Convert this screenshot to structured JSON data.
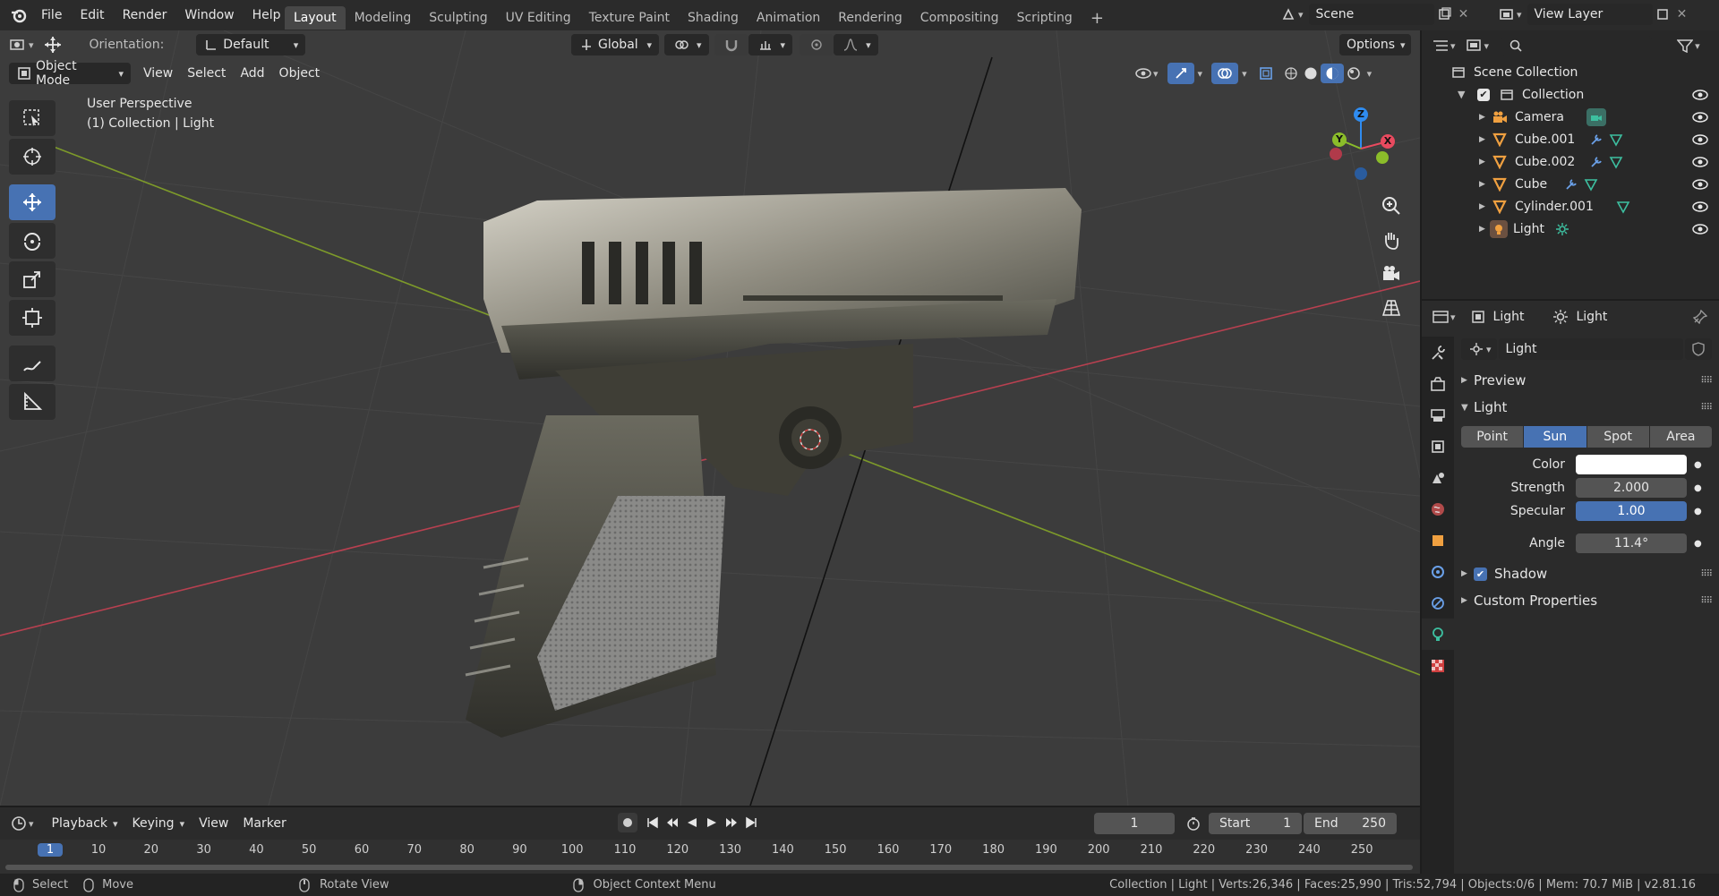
{
  "menu": [
    "File",
    "Edit",
    "Render",
    "Window",
    "Help"
  ],
  "workspaces": [
    {
      "label": "Layout",
      "active": true
    },
    {
      "label": "Modeling"
    },
    {
      "label": "Sculpting"
    },
    {
      "label": "UV Editing"
    },
    {
      "label": "Texture Paint"
    },
    {
      "label": "Shading"
    },
    {
      "label": "Animation"
    },
    {
      "label": "Rendering"
    },
    {
      "label": "Compositing"
    },
    {
      "label": "Scripting"
    }
  ],
  "add_workspace": "+",
  "scene": {
    "name": "Scene"
  },
  "view_layer": {
    "name": "View Layer"
  },
  "viewport": {
    "orientation_label": "Orientation:",
    "orientation_value": "Default",
    "transform_space": "Global",
    "options_label": "Options",
    "mode": "Object Mode",
    "header_menus": [
      "View",
      "Select",
      "Add",
      "Object"
    ],
    "overlay_text_line1": "User Perspective",
    "overlay_text_line2": "(1) Collection | Light",
    "gizmo_axes": {
      "z": "Z",
      "y": "Y",
      "x": "X"
    }
  },
  "outliner": {
    "search_placeholder": "",
    "root": "Scene Collection",
    "collection": "Collection",
    "items": [
      {
        "name": "Camera",
        "icon": "camera-object-icon",
        "extra": "camera-data-icon"
      },
      {
        "name": "Cube.001",
        "icon": "mesh-object-icon",
        "extra": "modifier-wrench-icon"
      },
      {
        "name": "Cube.002",
        "icon": "mesh-object-icon",
        "extra": "modifier-wrench-icon"
      },
      {
        "name": "Cube",
        "icon": "mesh-object-icon",
        "extra": "modifier-wrench-icon"
      },
      {
        "name": "Cylinder.001",
        "icon": "mesh-object-icon",
        "extra": "mesh-data-icon"
      },
      {
        "name": "Light",
        "icon": "light-object-icon",
        "extra": "sun-data-icon"
      }
    ]
  },
  "properties": {
    "breadcrumb_object": "Light",
    "breadcrumb_data": "Light",
    "datablock_name": "Light",
    "panels": {
      "preview": "Preview",
      "light": "Light",
      "shadow": "Shadow",
      "custom": "Custom Properties"
    },
    "light_types": [
      {
        "label": "Point"
      },
      {
        "label": "Sun",
        "active": true
      },
      {
        "label": "Spot"
      },
      {
        "label": "Area"
      }
    ],
    "fields": {
      "color_label": "Color",
      "strength_label": "Strength",
      "strength_value": "2.000",
      "specular_label": "Specular",
      "specular_value": "1.00",
      "angle_label": "Angle",
      "angle_value": "11.4°"
    },
    "shadow_checked": true
  },
  "timeline": {
    "menus": [
      "Playback",
      "Keying",
      "View",
      "Marker"
    ],
    "current_frame": "1",
    "start_label": "Start",
    "start_value": "1",
    "end_label": "End",
    "end_value": "250",
    "ruler": [
      "1",
      "10",
      "20",
      "30",
      "40",
      "50",
      "60",
      "70",
      "80",
      "90",
      "100",
      "110",
      "120",
      "130",
      "140",
      "150",
      "160",
      "170",
      "180",
      "190",
      "200",
      "210",
      "220",
      "230",
      "240",
      "250"
    ]
  },
  "status": {
    "select": "Select",
    "move": "Move",
    "rotate": "Rotate View",
    "context": "Object Context Menu",
    "stats": "Collection | Light | Verts:26,346 | Faces:25,990 | Tris:52,794 | Objects:0/6 | Mem: 70.7 MiB | v2.81.16"
  },
  "colors": {
    "accent": "#4772b3",
    "x_axis": "#e84a5f",
    "y_axis": "#8bbd2a",
    "z_axis": "#2f8cf0",
    "mesh_icon": "#f0a040",
    "data_icon": "#3dbfa0"
  }
}
